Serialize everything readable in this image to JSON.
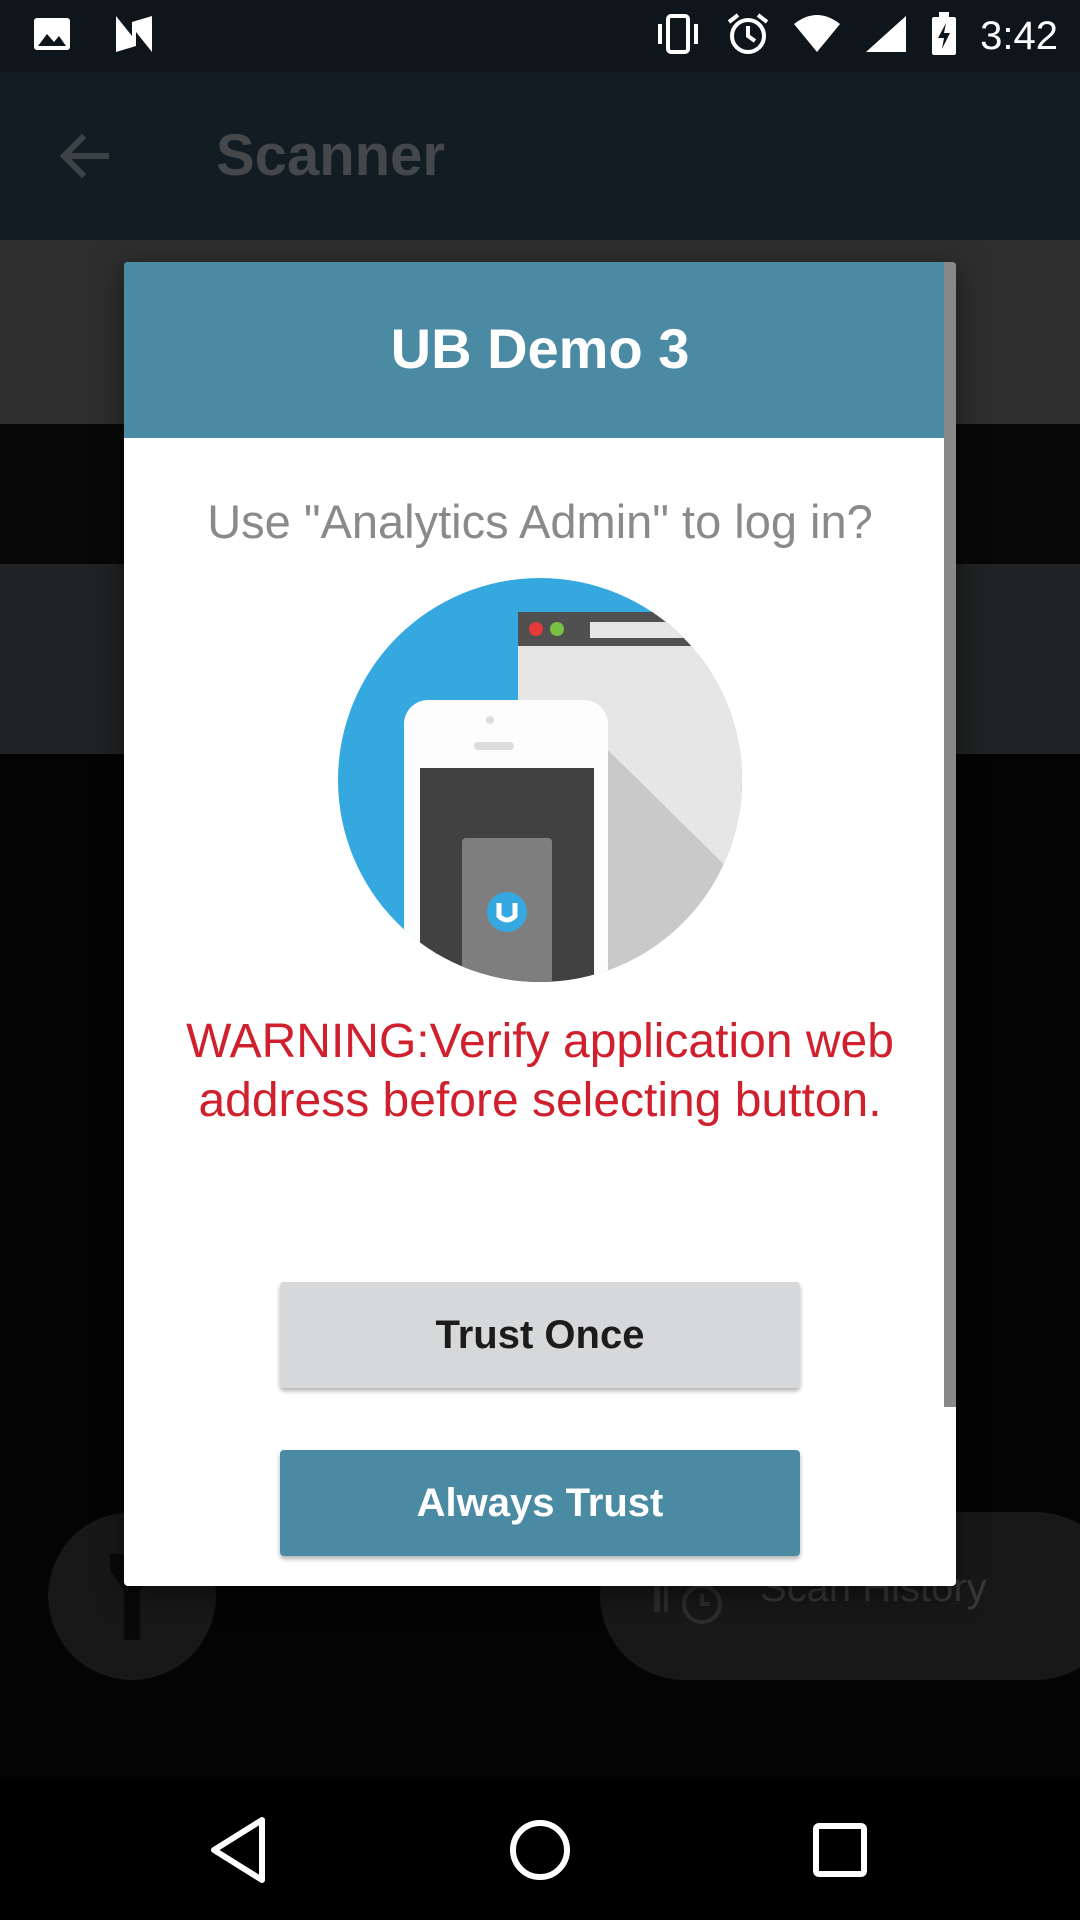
{
  "status_bar": {
    "time": "3:42",
    "left_icons": [
      "image-icon",
      "n-notification-icon"
    ],
    "right_icons": [
      "vibrate-icon",
      "alarm-icon",
      "wifi-icon",
      "cell-signal-icon",
      "battery-charging-icon"
    ]
  },
  "app_bar": {
    "title": "Scanner",
    "back_icon": "arrow-left-icon"
  },
  "camera_overlay": {
    "scan_history_label": "Scan History",
    "flashlight_icon": "flashlight-icon",
    "history_icon": "history-clock-icon"
  },
  "dialog": {
    "title": "UB Demo 3",
    "prompt": "Use \"Analytics Admin\" to log in?",
    "illustration": "phone-browser-illustration",
    "warning": "WARNING:Verify application web address before selecting button.",
    "trust_once_label": "Trust Once",
    "always_trust_label": "Always Trust"
  },
  "colors": {
    "header": "#4b8aa3",
    "warning": "#d0202e",
    "app_bar": "#1f3441",
    "illustration_blue": "#35a8e0"
  },
  "nav_bar": {
    "icons": [
      "back-triangle-icon",
      "home-circle-icon",
      "recents-square-icon"
    ]
  }
}
